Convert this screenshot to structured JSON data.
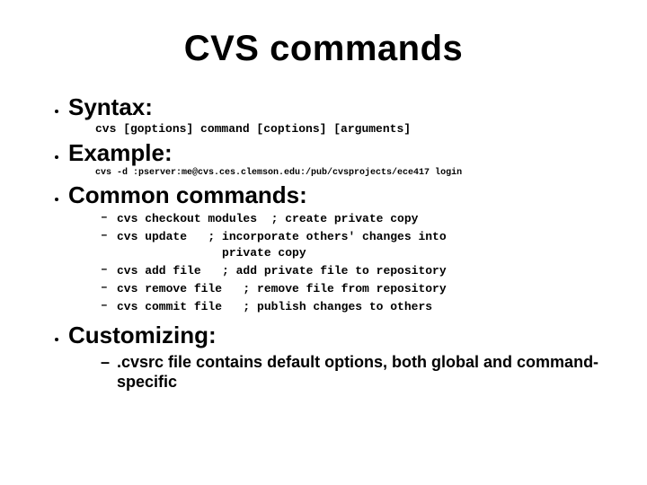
{
  "title": "CVS commands",
  "bullets": {
    "syntax": {
      "label": "Syntax:",
      "line": "cvs [goptions] command [coptions] [arguments]"
    },
    "example": {
      "label": "Example:",
      "line": "cvs -d :pserver:me@cvs.ces.clemson.edu:/pub/cvsprojects/ece417 login"
    },
    "common": {
      "label": "Common commands:",
      "cmds": [
        "cvs checkout modules  ; create private copy",
        "cvs update   ; incorporate others' changes into\n               private copy",
        "cvs add file   ; add private file to repository",
        "cvs remove file   ; remove file from repository",
        "cvs commit file   ; publish changes to others"
      ]
    },
    "custom": {
      "label": "Customizing:",
      "sub": ".cvsrc file contains default options, both global and command-specific"
    }
  }
}
